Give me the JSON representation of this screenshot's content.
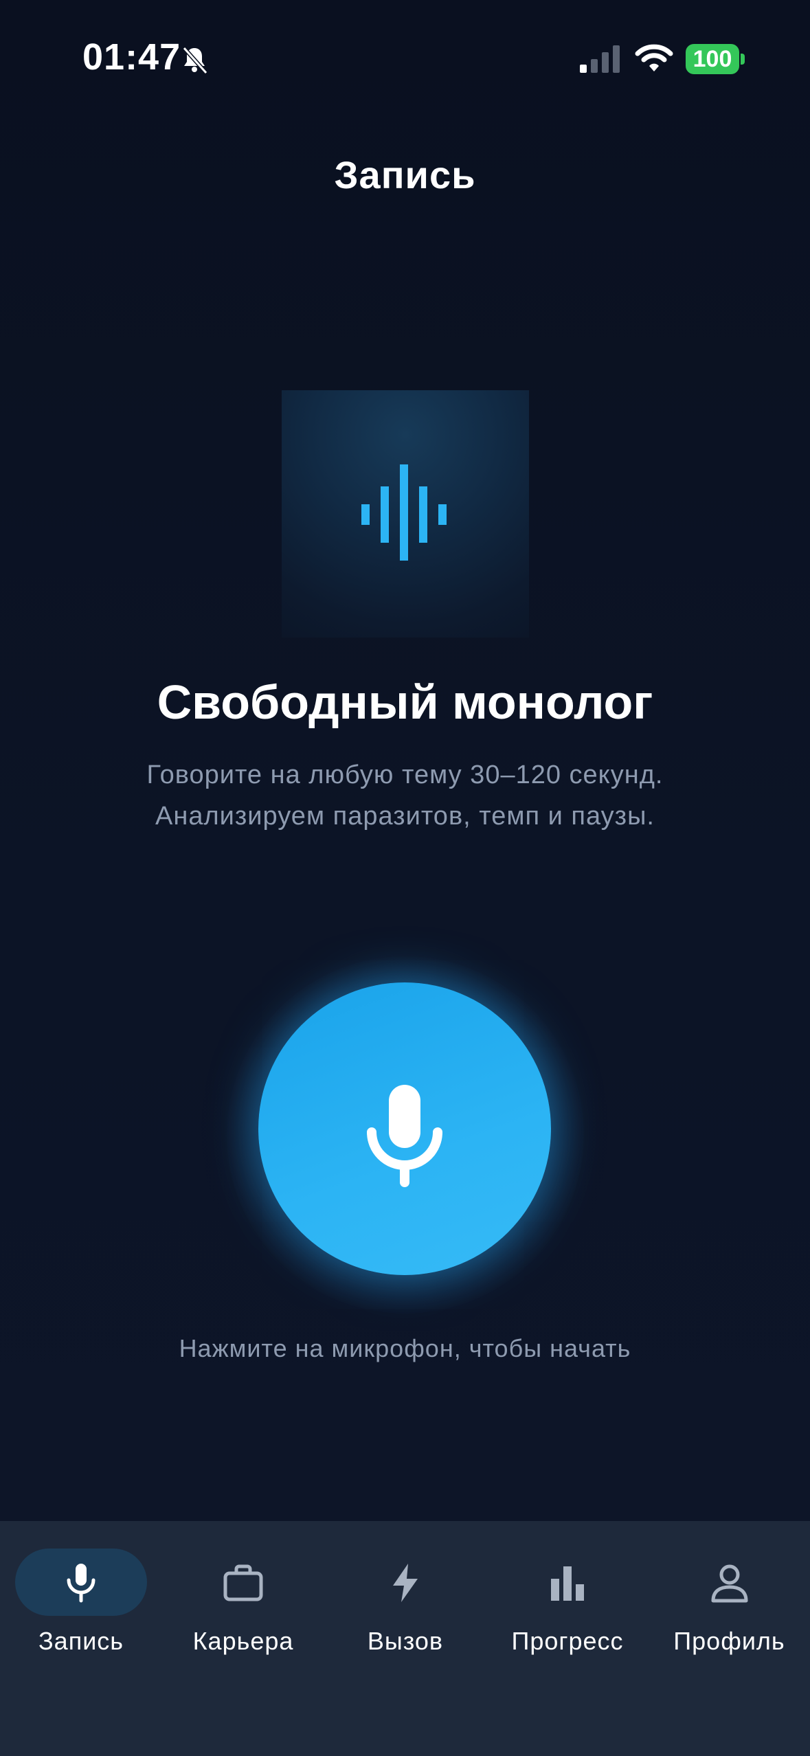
{
  "status_bar": {
    "time": "01:47",
    "battery": "100",
    "icons": [
      "bell-slash-icon",
      "cellular-signal-icon",
      "wifi-icon",
      "battery-icon"
    ]
  },
  "header": {
    "title": "Запись"
  },
  "mode": {
    "icon": "waveform-icon",
    "title": "Свободный монолог",
    "description_lines": [
      "Говорите на любую тему 30–120 секунд.",
      "Анализируем паразитов, темп и паузы."
    ]
  },
  "record": {
    "icon": "microphone-icon",
    "hint": "Нажмите на микрофон, чтобы начать"
  },
  "tabs": [
    {
      "label": "Запись",
      "icon": "microphone-icon",
      "active": true
    },
    {
      "label": "Карьера",
      "icon": "briefcase-icon",
      "active": false
    },
    {
      "label": "Вызов",
      "icon": "bolt-icon",
      "active": false
    },
    {
      "label": "Прогресс",
      "icon": "bar-chart-icon",
      "active": false
    },
    {
      "label": "Профиль",
      "icon": "person-icon",
      "active": false
    }
  ],
  "colors": {
    "background": "#0b1120",
    "accent": "#2cb4f4",
    "tabbar": "#1e293b",
    "active_tab_pill": "#1c3d59",
    "muted_text": "#8e9bb0",
    "battery": "#34c759"
  }
}
